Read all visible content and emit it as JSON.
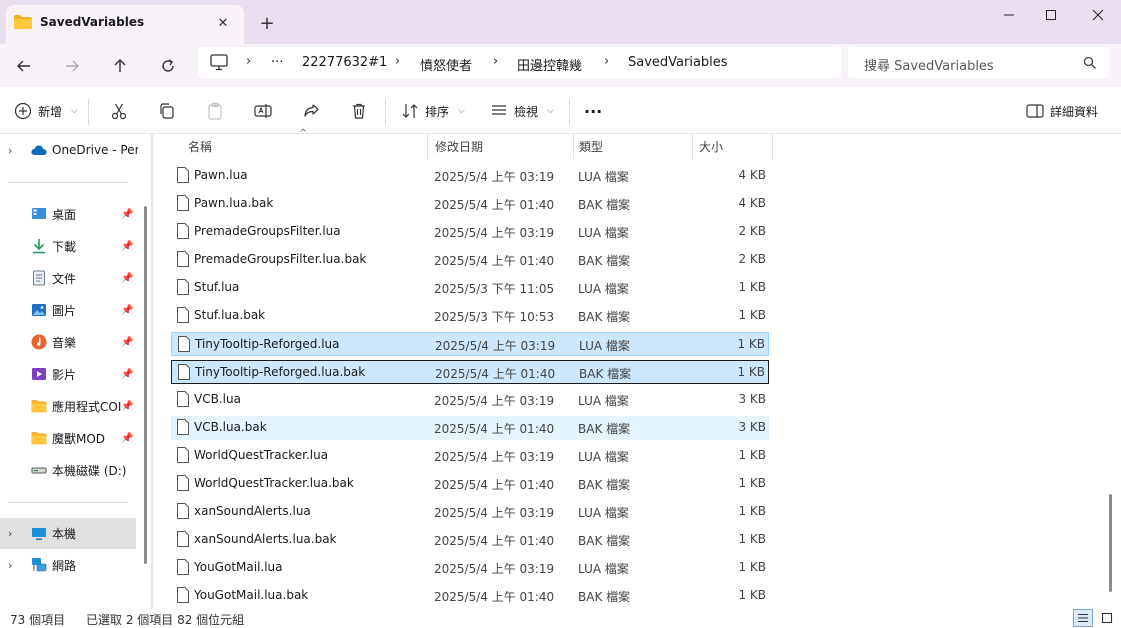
{
  "window": {
    "tab_title": "SavedVariables",
    "new_tab": "+",
    "close_tab": "✕"
  },
  "address": {
    "crumbs": [
      "22277632#1",
      "憤怒使者",
      "田邊控韓幾",
      "SavedVariables"
    ],
    "more": "···",
    "search_placeholder": "搜尋 SavedVariables"
  },
  "toolbar": {
    "new_label": "新增",
    "sort_label": "排序",
    "view_label": "檢視",
    "more_label": "···",
    "details_label": "詳細資料"
  },
  "sidebar": {
    "onedrive": "OneDrive - Pers",
    "items": [
      {
        "label": "桌面",
        "icon": "desktop-icon"
      },
      {
        "label": "下載",
        "icon": "download-icon"
      },
      {
        "label": "文件",
        "icon": "documents-icon"
      },
      {
        "label": "圖片",
        "icon": "pictures-icon"
      },
      {
        "label": "音樂",
        "icon": "music-icon"
      },
      {
        "label": "影片",
        "icon": "videos-icon"
      },
      {
        "label": "應用程式COI",
        "icon": "folder-icon"
      },
      {
        "label": "魔獸MOD",
        "icon": "folder-icon"
      },
      {
        "label": "本機磁碟 (D:)",
        "icon": "drive-icon"
      }
    ],
    "this_pc": "本機",
    "network": "網路"
  },
  "columns": {
    "name": "名稱",
    "date": "修改日期",
    "type": "類型",
    "size": "大小"
  },
  "files": [
    {
      "name": "Pawn.lua",
      "date": "2025/5/4 上午 03:19",
      "type": "LUA 檔案",
      "size": "4 KB"
    },
    {
      "name": "Pawn.lua.bak",
      "date": "2025/5/4 上午 01:40",
      "type": "BAK 檔案",
      "size": "4 KB"
    },
    {
      "name": "PremadeGroupsFilter.lua",
      "date": "2025/5/4 上午 03:19",
      "type": "LUA 檔案",
      "size": "2 KB"
    },
    {
      "name": "PremadeGroupsFilter.lua.bak",
      "date": "2025/5/4 上午 01:40",
      "type": "BAK 檔案",
      "size": "2 KB"
    },
    {
      "name": "Stuf.lua",
      "date": "2025/5/3 下午 11:05",
      "type": "LUA 檔案",
      "size": "1 KB"
    },
    {
      "name": "Stuf.lua.bak",
      "date": "2025/5/3 下午 10:53",
      "type": "BAK 檔案",
      "size": "1 KB"
    },
    {
      "name": "TinyTooltip-Reforged.lua",
      "date": "2025/5/4 上午 03:19",
      "type": "LUA 檔案",
      "size": "1 KB"
    },
    {
      "name": "TinyTooltip-Reforged.lua.bak",
      "date": "2025/5/4 上午 01:40",
      "type": "BAK 檔案",
      "size": "1 KB"
    },
    {
      "name": "VCB.lua",
      "date": "2025/5/4 上午 03:19",
      "type": "LUA 檔案",
      "size": "3 KB"
    },
    {
      "name": "VCB.lua.bak",
      "date": "2025/5/4 上午 01:40",
      "type": "BAK 檔案",
      "size": "3 KB"
    },
    {
      "name": "WorldQuestTracker.lua",
      "date": "2025/5/4 上午 03:19",
      "type": "LUA 檔案",
      "size": "1 KB"
    },
    {
      "name": "WorldQuestTracker.lua.bak",
      "date": "2025/5/4 上午 01:40",
      "type": "BAK 檔案",
      "size": "1 KB"
    },
    {
      "name": "xanSoundAlerts.lua",
      "date": "2025/5/4 上午 03:19",
      "type": "LUA 檔案",
      "size": "1 KB"
    },
    {
      "name": "xanSoundAlerts.lua.bak",
      "date": "2025/5/4 上午 01:40",
      "type": "BAK 檔案",
      "size": "1 KB"
    },
    {
      "name": "YouGotMail.lua",
      "date": "2025/5/4 上午 03:19",
      "type": "LUA 檔案",
      "size": "1 KB"
    },
    {
      "name": "YouGotMail.lua.bak",
      "date": "2025/5/4 上午 01:40",
      "type": "BAK 檔案",
      "size": "1 KB"
    }
  ],
  "status": {
    "count": "73 個項目",
    "selected": "已選取 2 個項目 82 個位元組"
  },
  "colors": {
    "selected_bg": "#cce8ff",
    "hover_bg": "#e5f3ff",
    "title_bg": "#e9dfee"
  }
}
